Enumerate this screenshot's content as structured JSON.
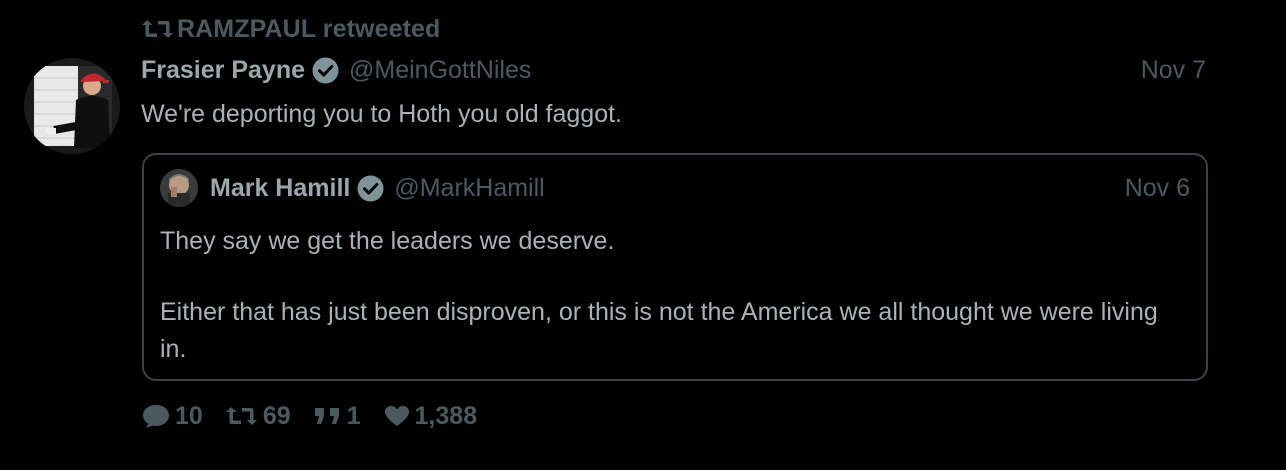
{
  "retweet_context": {
    "label": "RAMZPAUL retweeted",
    "icon": "retweet-icon"
  },
  "tweet": {
    "display_name": "Frasier Payne",
    "verified": true,
    "handle": "@MeinGottNiles",
    "date": "Nov 7",
    "text": "We're deporting you to Hoth you old faggot.",
    "avatar_icon": "profile-avatar"
  },
  "quoted_tweet": {
    "display_name": "Mark Hamill",
    "verified": true,
    "handle": "@MarkHamill",
    "date": "Nov 6",
    "paragraphs": [
      "They say we get the leaders we deserve.",
      "Either that has just been disproven, or this is not the America we all thought we were living in."
    ],
    "avatar_icon": "profile-avatar"
  },
  "actions": {
    "replies": "10",
    "retweets": "69",
    "quotes": "1",
    "likes": "1,388"
  },
  "colors": {
    "background": "#000000",
    "muted": "#4b5a5f",
    "text": "#a9b3b6",
    "name": "#9aa7ab",
    "verified_badge": "#7f9499",
    "card_border": "#3a4245",
    "cap_red": "#c0262d"
  }
}
